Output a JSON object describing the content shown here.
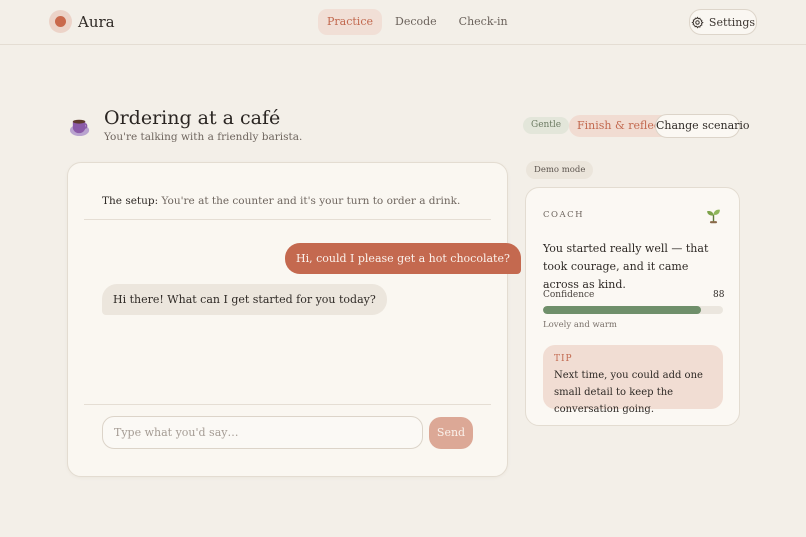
{
  "app": {
    "name": "Aura"
  },
  "nav": {
    "tabs": [
      {
        "label": "Practice",
        "active": true
      },
      {
        "label": "Decode",
        "active": false
      },
      {
        "label": "Check-in",
        "active": false
      }
    ],
    "settings_label": "Settings"
  },
  "scenario": {
    "title": "Ordering at a café",
    "subtitle": "You're talking with a friendly barista.",
    "icon": "coffee-cup-icon",
    "mode_badge": "Gentle",
    "finish_label": "Finish & reflect",
    "change_label": "Change scenario"
  },
  "chat": {
    "setup_label": "The setup:",
    "setup_text": "You're at the counter and it's your turn to order a drink.",
    "messages": [
      {
        "role": "user",
        "text": "Hi, could I please get a hot chocolate?"
      },
      {
        "role": "assistant",
        "text": "Hi there! What can I get started for you today?"
      }
    ],
    "input_placeholder": "Type what you'd say…",
    "send_label": "Send"
  },
  "coach": {
    "demo_badge": "Demo mode",
    "title": "COACH",
    "icon": "sprout-icon",
    "feedback": "You started really well — that took courage, and it came across as kind.",
    "confidence_label": "Confidence",
    "confidence_value": "88",
    "confidence_percent": 88,
    "confidence_note": "Lovely and warm",
    "tip_label": "TIP",
    "tip_text": "Next time, you could add one small detail to keep the conversation going."
  },
  "colors": {
    "background": "#f3efe8",
    "accent": "#c4694f",
    "accent_soft": "#f1dcd2",
    "confidence_bar": "#6f8f6a",
    "gentle_badge": "#e3e6da"
  }
}
